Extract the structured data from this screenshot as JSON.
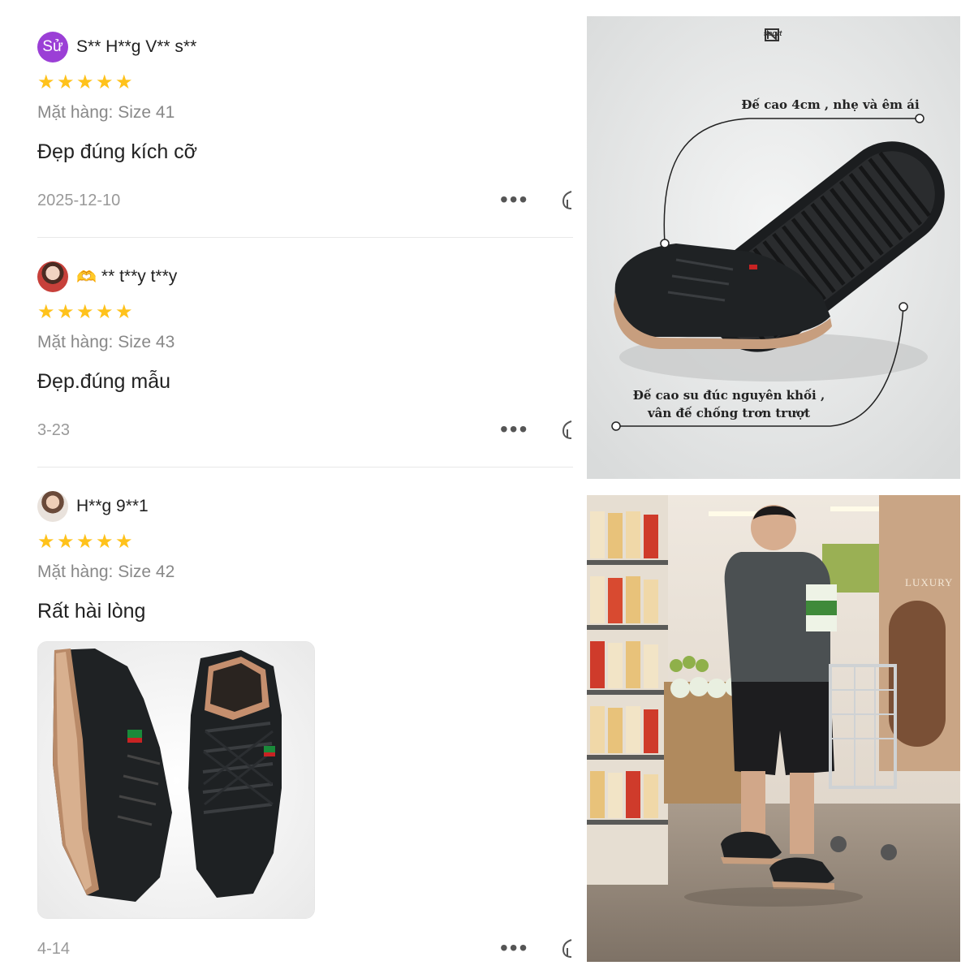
{
  "reviews": [
    {
      "avatar_text": "Sử",
      "username": "S** H**g V** s**",
      "rating": 5,
      "variant": "Mặt hàng: Size 41",
      "content": "Đẹp đúng kích cỡ",
      "date": "2025-12-10"
    },
    {
      "username": "** t**y t**y",
      "rating": 5,
      "variant": "Mặt hàng: Size 43",
      "content": "Đẹp.đúng mẫu",
      "date": "3-23"
    },
    {
      "username": "H**g 9**1",
      "rating": 5,
      "variant": "Mặt hàng: Size 42",
      "content": "Rất hài lòng",
      "date": "4-14"
    }
  ],
  "icons": {
    "star": "star-icon",
    "more": "more-horizontal-icon",
    "like": "thumbs-up-icon",
    "hands": "heart-hands-emoji"
  },
  "colors": {
    "star": "#ffc21b",
    "avatar_bg": "#9b3fd6",
    "muted_text": "#888888"
  },
  "product_image": {
    "brand": "sport",
    "annotation_top": "Đế cao 4cm , nhẹ và êm ái",
    "annotation_bottom_line1": "Đế cao su đúc nguyên khối ,",
    "annotation_bottom_line2": "vân đế chống trơn trượt"
  },
  "lifestyle_image": {
    "sign_text": "LUXURY"
  }
}
